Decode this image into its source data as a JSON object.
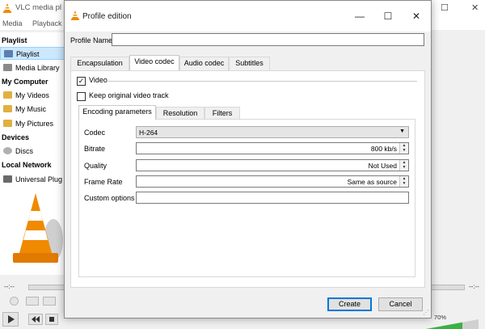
{
  "vlc": {
    "title": "VLC media pl",
    "menu": [
      "Media",
      "Playback"
    ],
    "sidebar": {
      "playlist_header": "Playlist",
      "playlist_item": "Playlist",
      "media_library": "Media Library",
      "my_computer_header": "My Computer",
      "my_videos": "My Videos",
      "my_music": "My Music",
      "my_pictures": "My Pictures",
      "devices_header": "Devices",
      "discs": "Discs",
      "local_network_header": "Local Network",
      "universal_plug": "Universal Plug"
    },
    "elapsed": "--:--",
    "total": "--:--",
    "volume": "70%"
  },
  "dialog": {
    "title": "Profile edition",
    "profile_name_label": "Profile Name",
    "profile_name_value": "",
    "tabs": [
      "Encapsulation",
      "Video codec",
      "Audio codec",
      "Subtitles"
    ],
    "active_tab": "Video codec",
    "video_checkbox_label": "Video",
    "video_checked": true,
    "keep_original_label": "Keep original video track",
    "keep_original_checked": false,
    "inner_tabs": [
      "Encoding parameters",
      "Resolution",
      "Filters"
    ],
    "active_inner_tab": "Encoding parameters",
    "codec_label": "Codec",
    "codec_value": "H-264",
    "bitrate_label": "Bitrate",
    "bitrate_value": "800 kb/s",
    "quality_label": "Quality",
    "quality_value": "Not Used",
    "frame_rate_label": "Frame Rate",
    "frame_rate_value": "Same as source",
    "custom_options_label": "Custom options",
    "custom_options_value": "",
    "create_label": "Create",
    "cancel_label": "Cancel"
  },
  "colors": {
    "accent": "#0078d7",
    "cone_orange": "#f08a00",
    "selection": "#cce8ff",
    "volume_green": "#3cb043"
  }
}
